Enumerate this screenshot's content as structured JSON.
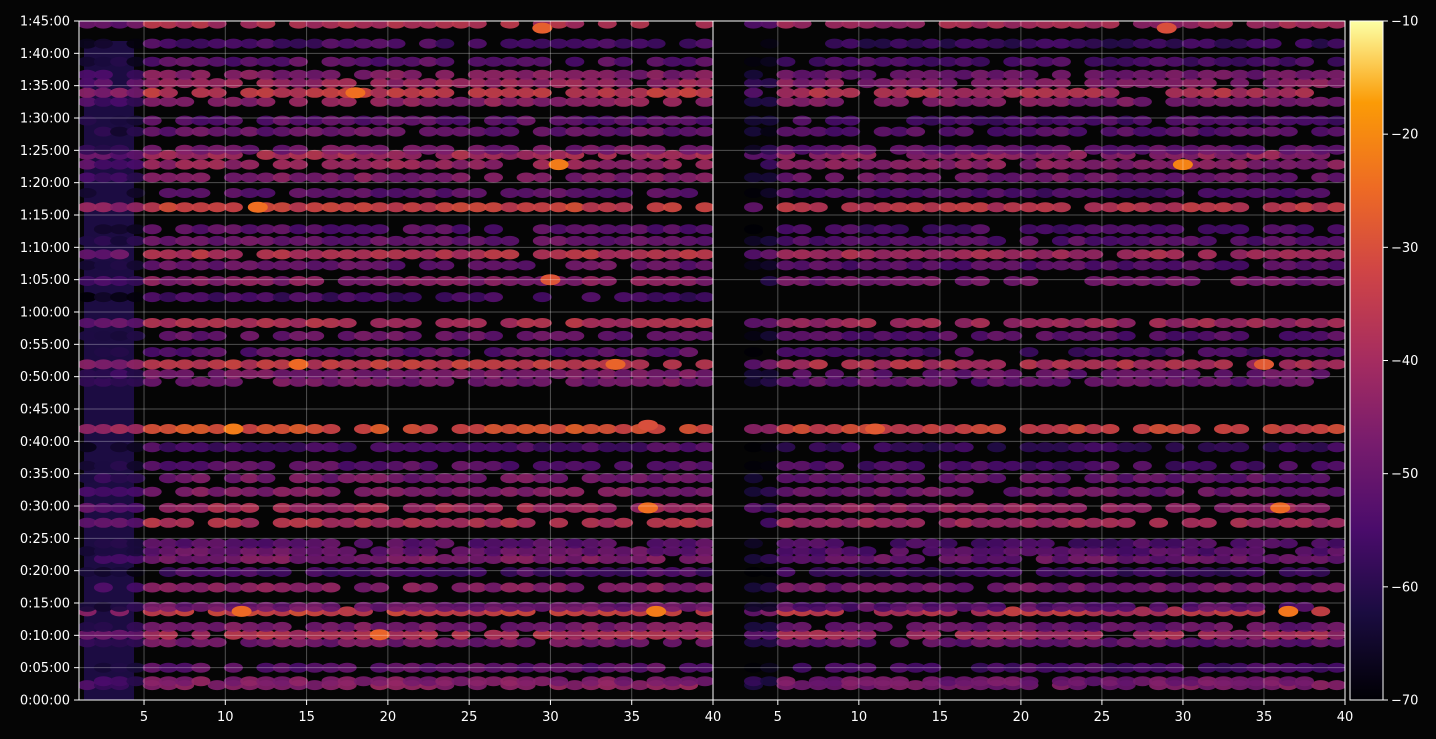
{
  "chart_data": {
    "type": "heatmap",
    "title": "",
    "xlabel": "",
    "ylabel": "",
    "panels": [
      {
        "name": "left",
        "xlim": [
          1,
          40
        ],
        "x_ticks": [
          5,
          10,
          15,
          20,
          25,
          30,
          35,
          40
        ]
      },
      {
        "name": "right",
        "xlim": [
          1,
          40
        ],
        "x_ticks": [
          5,
          10,
          15,
          20,
          25,
          30,
          35,
          40
        ]
      }
    ],
    "x_tick_labels": [
      "5",
      "10",
      "15",
      "20",
      "25",
      "30",
      "35",
      "40"
    ],
    "y_tick_labels": [
      "0:00:00",
      "0:05:00",
      "0:10:00",
      "0:15:00",
      "0:20:00",
      "0:25:00",
      "0:30:00",
      "0:35:00",
      "0:40:00",
      "0:45:00",
      "0:50:00",
      "0:55:00",
      "1:00:00",
      "1:05:00",
      "1:10:00",
      "1:15:00",
      "1:20:00",
      "1:25:00",
      "1:30:00",
      "1:35:00",
      "1:40:00",
      "1:45:00"
    ],
    "ylim_minutes": [
      0,
      105
    ],
    "grid": true,
    "colormap": "inferno",
    "colorbar": {
      "min": -70,
      "max": -10,
      "ticks": [
        -70,
        -60,
        -50,
        -40,
        -30,
        -20,
        -10
      ],
      "tick_labels": [
        "−70",
        "−60",
        "−50",
        "−40",
        "−30",
        "−20",
        "−10"
      ]
    },
    "bands": [
      {
        "t": 2.3,
        "level": -44,
        "left_only": false
      },
      {
        "t": 2.9,
        "level": -46,
        "left_only": false
      },
      {
        "t": 5.0,
        "level": -52,
        "left_only": false
      },
      {
        "t": 8.9,
        "level": -48,
        "left_only": false
      },
      {
        "t": 10.1,
        "level": -38,
        "left_only": false
      },
      {
        "t": 11.3,
        "level": -47,
        "left_only": false
      },
      {
        "t": 13.7,
        "level": -33,
        "left_only": false
      },
      {
        "t": 14.4,
        "level": -50,
        "left_only": false
      },
      {
        "t": 17.4,
        "level": -45,
        "left_only": false
      },
      {
        "t": 19.8,
        "level": -55,
        "left_only": false
      },
      {
        "t": 21.8,
        "level": -47,
        "left_only": false
      },
      {
        "t": 23.0,
        "level": -50,
        "left_only": false
      },
      {
        "t": 24.2,
        "level": -52,
        "left_only": false
      },
      {
        "t": 27.4,
        "level": -38,
        "left_only": false
      },
      {
        "t": 29.7,
        "level": -40,
        "left_only": false
      },
      {
        "t": 32.2,
        "level": -46,
        "left_only": false
      },
      {
        "t": 34.3,
        "level": -48,
        "left_only": false
      },
      {
        "t": 36.2,
        "level": -52,
        "left_only": false
      },
      {
        "t": 39.1,
        "level": -55,
        "left_only": false
      },
      {
        "t": 41.9,
        "level": -30,
        "left_only": false
      },
      {
        "t": 49.2,
        "level": -48,
        "left_only": false
      },
      {
        "t": 50.4,
        "level": -47,
        "left_only": false
      },
      {
        "t": 51.9,
        "level": -35,
        "left_only": false
      },
      {
        "t": 53.8,
        "level": -52,
        "left_only": false
      },
      {
        "t": 56.3,
        "level": -50,
        "left_only": false
      },
      {
        "t": 58.3,
        "level": -38,
        "left_only": false
      },
      {
        "t": 62.3,
        "level": -56,
        "left_only": true
      },
      {
        "t": 64.8,
        "level": -45,
        "left_only": false
      },
      {
        "t": 67.2,
        "level": -50,
        "left_only": false
      },
      {
        "t": 68.9,
        "level": -37,
        "left_only": false
      },
      {
        "t": 71.0,
        "level": -50,
        "left_only": false
      },
      {
        "t": 72.8,
        "level": -52,
        "left_only": false
      },
      {
        "t": 76.2,
        "level": -33,
        "left_only": false
      },
      {
        "t": 78.4,
        "level": -52,
        "left_only": false
      },
      {
        "t": 80.8,
        "level": -46,
        "left_only": false
      },
      {
        "t": 82.8,
        "level": -42,
        "left_only": false
      },
      {
        "t": 84.3,
        "level": -40,
        "left_only": false
      },
      {
        "t": 85.1,
        "level": -48,
        "left_only": false
      },
      {
        "t": 87.9,
        "level": -50,
        "left_only": false
      },
      {
        "t": 89.6,
        "level": -52,
        "left_only": false
      },
      {
        "t": 92.5,
        "level": -44,
        "left_only": false
      },
      {
        "t": 93.9,
        "level": -35,
        "left_only": false
      },
      {
        "t": 95.4,
        "level": -42,
        "left_only": false
      },
      {
        "t": 96.7,
        "level": -46,
        "left_only": false
      },
      {
        "t": 98.7,
        "level": -52,
        "left_only": false
      },
      {
        "t": 101.5,
        "level": -55,
        "left_only": false
      },
      {
        "t": 104.6,
        "level": -38,
        "left_only": false
      }
    ],
    "hotspots": [
      {
        "panel": "left",
        "x": 10.5,
        "t": 41.9,
        "level": -22
      },
      {
        "panel": "left",
        "x": 12,
        "t": 76.2,
        "level": -24
      },
      {
        "panel": "left",
        "x": 14.5,
        "t": 51.9,
        "level": -25
      },
      {
        "panel": "left",
        "x": 18,
        "t": 93.9,
        "level": -24
      },
      {
        "panel": "left",
        "x": 19.5,
        "t": 10.1,
        "level": -26
      },
      {
        "panel": "left",
        "x": 11,
        "t": 13.7,
        "level": -25
      },
      {
        "panel": "left",
        "x": 29.5,
        "t": 103.9,
        "level": -27
      },
      {
        "panel": "left",
        "x": 30.5,
        "t": 82.8,
        "level": -22
      },
      {
        "panel": "left",
        "x": 36.5,
        "t": 13.7,
        "level": -22
      },
      {
        "panel": "left",
        "x": 36,
        "t": 29.7,
        "level": -24
      },
      {
        "panel": "left",
        "x": 34,
        "t": 51.9,
        "level": -26
      },
      {
        "panel": "left",
        "x": 30,
        "t": 65.0,
        "level": -29
      },
      {
        "panel": "left",
        "x": 36,
        "t": 42.5,
        "level": -30
      },
      {
        "panel": "right",
        "x": 30,
        "t": 82.8,
        "level": -21
      },
      {
        "panel": "right",
        "x": 36.5,
        "t": 13.7,
        "level": -23
      },
      {
        "panel": "right",
        "x": 36,
        "t": 29.7,
        "level": -25
      },
      {
        "panel": "right",
        "x": 35,
        "t": 51.9,
        "level": -28
      },
      {
        "panel": "right",
        "x": 29,
        "t": 103.9,
        "level": -30
      },
      {
        "panel": "right",
        "x": 11,
        "t": 41.9,
        "level": -28
      }
    ]
  }
}
